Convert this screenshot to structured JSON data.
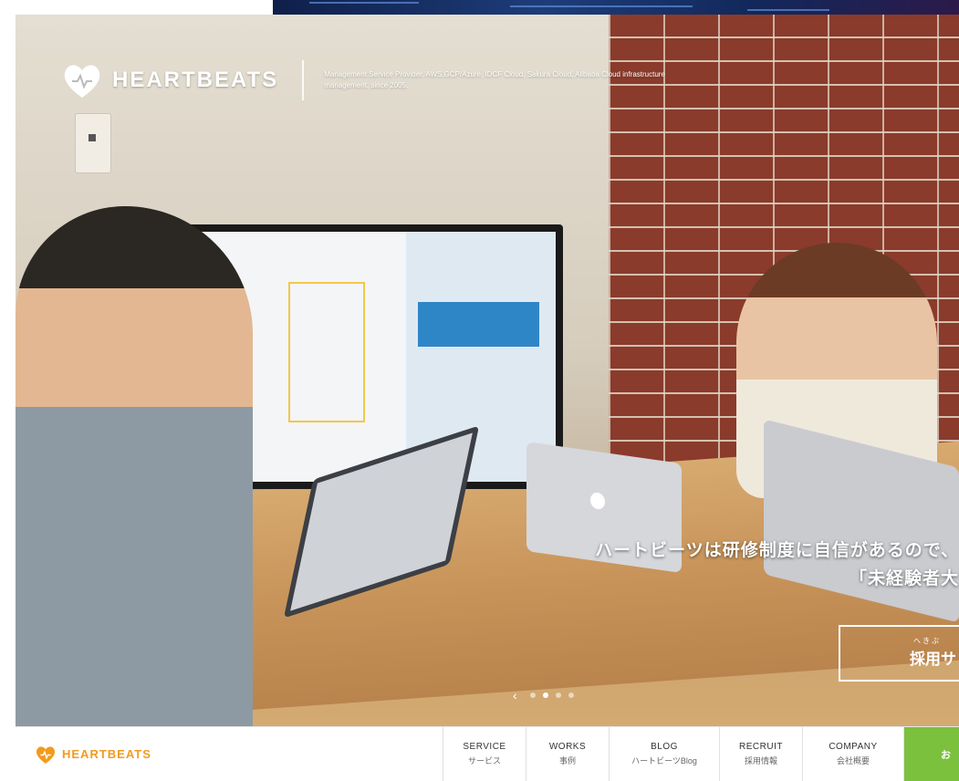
{
  "brand": {
    "name": "HEARTBEATS",
    "tagline": "Management Service Provider. AWS,GCP/Azure, IDCF Cloud, Sakura Cloud, Alibaba Cloud infrastructure management, since 2005."
  },
  "hero": {
    "caption_line1": "ハートビーツは研修制度に自信があるので、",
    "caption_line2": "「未経験者大",
    "cta_ruby": "へきぶ",
    "cta_label": "採用サ",
    "slides_prev": "‹",
    "slide_count": 4,
    "active_slide": 2
  },
  "nav": {
    "logo_text": "HEARTBEATS",
    "items": [
      {
        "en": "SERVICE",
        "ja": "サービス"
      },
      {
        "en": "WORKS",
        "ja": "事例"
      },
      {
        "en": "BLOG",
        "ja": "ハートビーツBlog"
      },
      {
        "en": "RECRUIT",
        "ja": "採用情報"
      },
      {
        "en": "COMPANY",
        "ja": "会社概要"
      }
    ],
    "contact": "お"
  },
  "colors": {
    "accent_orange": "#f39a1e",
    "cta_green": "#7cc13e"
  }
}
